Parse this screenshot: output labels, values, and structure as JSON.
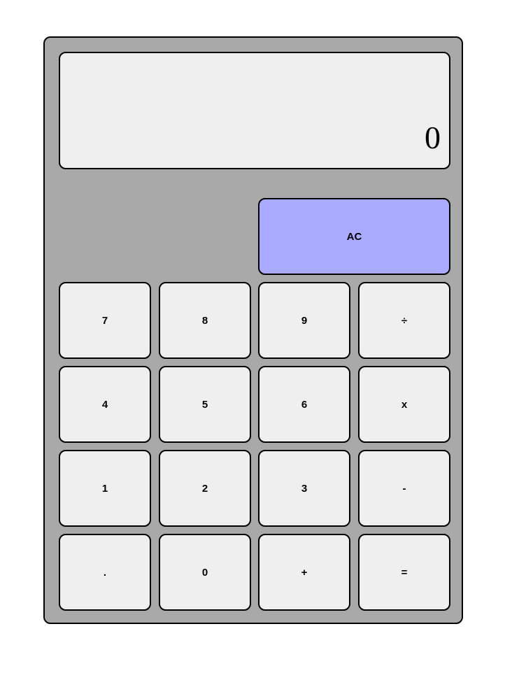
{
  "display": {
    "value": "0"
  },
  "keys": {
    "clear": "AC",
    "row1": [
      "7",
      "8",
      "9",
      "÷"
    ],
    "row2": [
      "4",
      "5",
      "6",
      "x"
    ],
    "row3": [
      "1",
      "2",
      "3",
      "-"
    ],
    "row4": [
      ".",
      "0",
      "+",
      "="
    ]
  },
  "colors": {
    "body": "#a9a9a9",
    "key": "#efefef",
    "clear_key": "#aaaaff",
    "display": "#efefef"
  }
}
